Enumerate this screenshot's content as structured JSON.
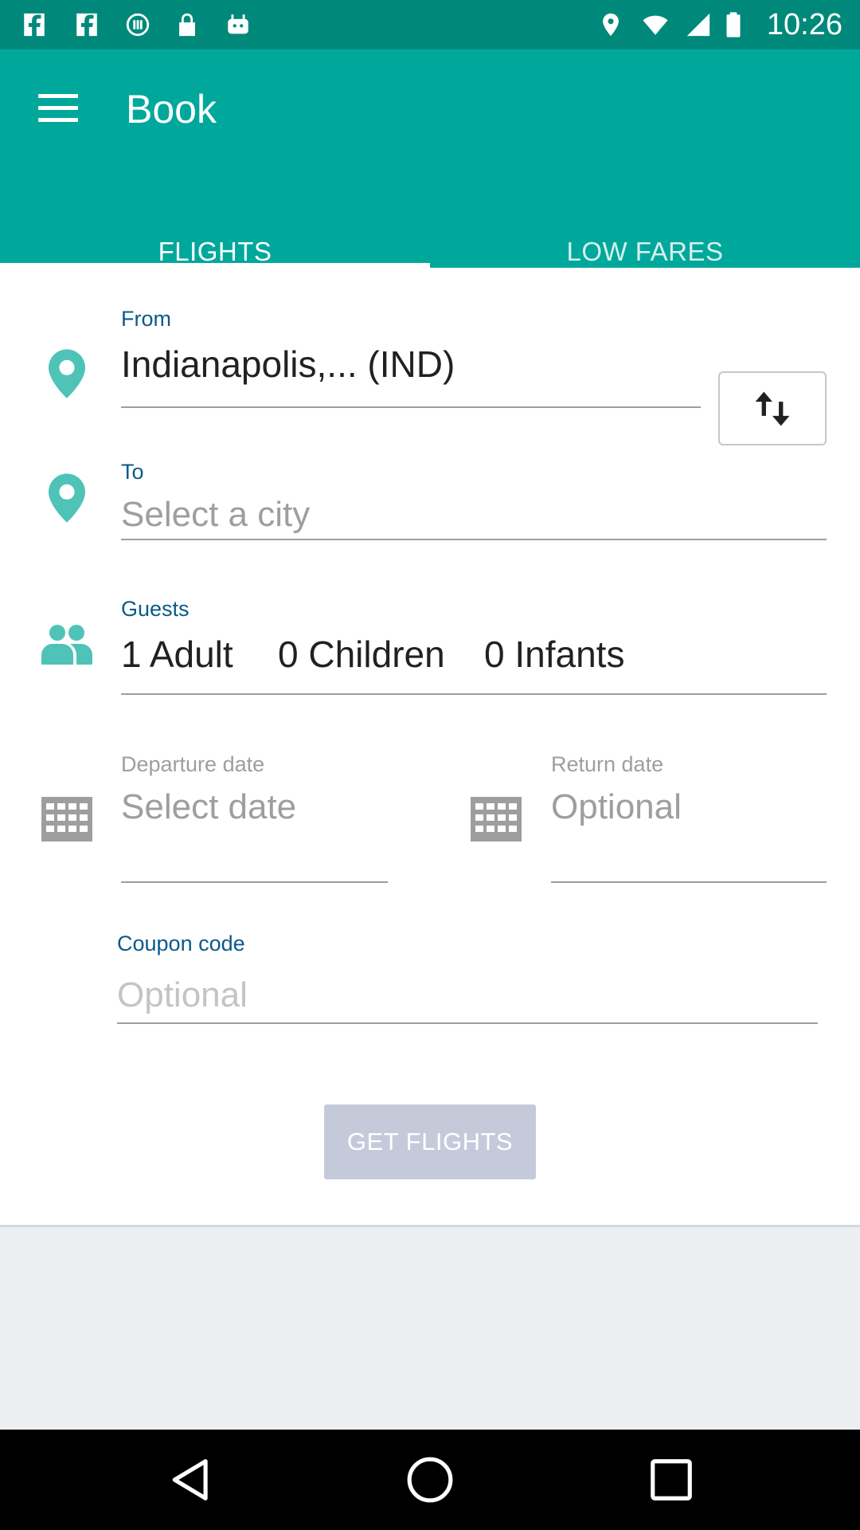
{
  "status_bar": {
    "time": "10:26",
    "left_icons": [
      "facebook-icon",
      "facebook-icon",
      "phone-signal-icon",
      "lock-icon",
      "android-icon"
    ],
    "right_icons": [
      "location-icon",
      "wifi-icon",
      "signal-icon",
      "battery-icon"
    ]
  },
  "app_bar": {
    "title": "Book",
    "tabs": [
      {
        "label": "FLIGHTS",
        "active": true
      },
      {
        "label": "LOW FARES",
        "active": false
      }
    ]
  },
  "form": {
    "from": {
      "label": "From",
      "value": "Indianapolis,... (IND)"
    },
    "to": {
      "label": "To",
      "placeholder": "Select a city"
    },
    "guests": {
      "label": "Guests",
      "adults": "1 Adult",
      "children": "0 Children",
      "infants": "0 Infants"
    },
    "departure": {
      "label": "Departure date",
      "placeholder": "Select date"
    },
    "return": {
      "label": "Return date",
      "placeholder": "Optional"
    },
    "coupon": {
      "label": "Coupon code",
      "placeholder": "Optional"
    },
    "submit_label": "GET FLIGHTS"
  },
  "colors": {
    "primary": "#00a89b",
    "status_bar": "#00897b",
    "label_blue": "#0a5a8a",
    "icon_teal": "#4fc3b7",
    "button_disabled": "#c5cadb"
  }
}
